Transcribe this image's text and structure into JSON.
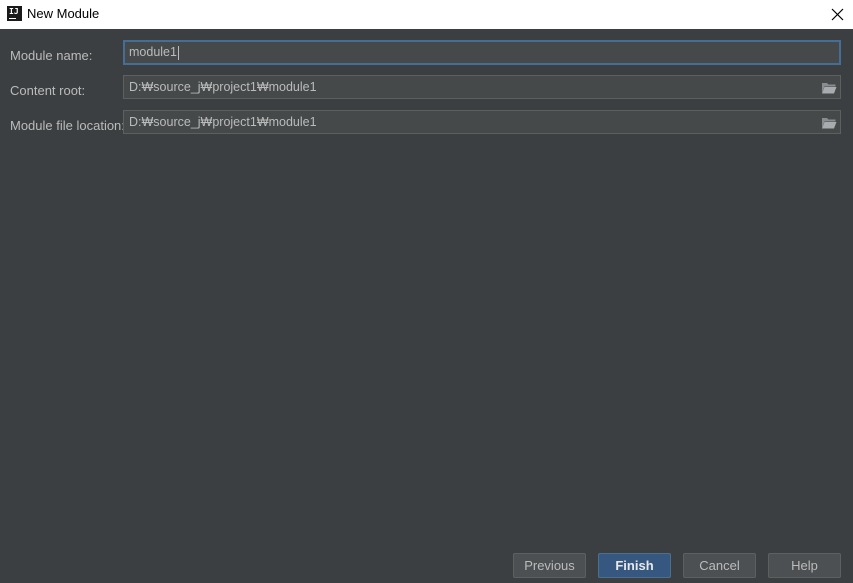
{
  "window": {
    "title": "New Module",
    "app_icon_text": "IJ"
  },
  "form": {
    "module_name": {
      "label": "Module name:",
      "value": "module1"
    },
    "content_root": {
      "label": "Content root:",
      "value": "D:₩source_j₩project1₩module1",
      "browse_icon": "folder-icon"
    },
    "module_file_location": {
      "label": "Module file location:",
      "value": "D:₩source_j₩project1₩module1",
      "browse_icon": "folder-icon"
    }
  },
  "buttons": {
    "previous": "Previous",
    "finish": "Finish",
    "cancel": "Cancel",
    "help": "Help"
  },
  "colors": {
    "background": "#3c3f41",
    "field_background": "#45494a",
    "focus_border": "#466d94",
    "primary_button": "#365880",
    "text": "#bbbbbb"
  }
}
